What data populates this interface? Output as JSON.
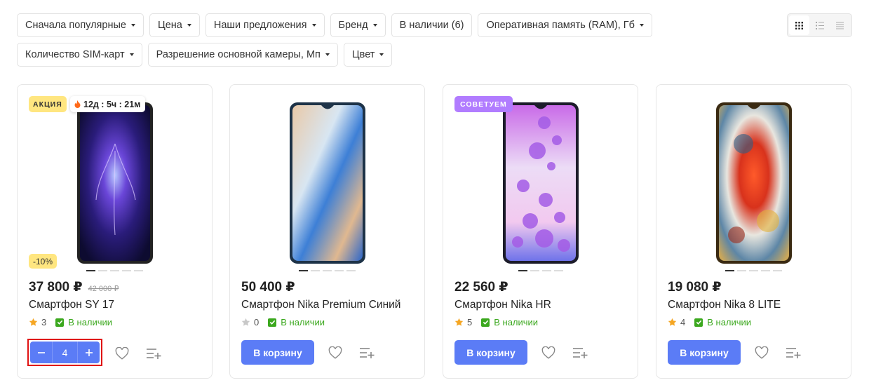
{
  "filters": {
    "row1": [
      "Сначала популярные",
      "Цена",
      "Наши предложения",
      "Бренд",
      "В наличии (6)",
      "Оперативная память (RAM), Гб"
    ],
    "row1_caret": [
      true,
      true,
      true,
      true,
      false,
      true
    ],
    "row2": [
      "Количество SIM-карт",
      "Разрешение основной камеры, Мп",
      "Цвет"
    ]
  },
  "view_modes": [
    "grid-view-icon",
    "list-view-icon",
    "compact-list-icon"
  ],
  "colors": {
    "accent": "#5b7cf6",
    "in_stock": "#3ba81e",
    "promo_badge": "#ffe680",
    "recommend_badge": "#b17cff",
    "highlight": "#e01212"
  },
  "products": [
    {
      "badge": "АКЦИЯ",
      "timer": "12д : 5ч : 21м",
      "discount": "-10%",
      "price": "37 800 ₽",
      "old_price": "42 000 ₽",
      "title": "Смартфон SY 17",
      "rating": "3",
      "rating_active": true,
      "stock": "В наличии",
      "quantity": "4",
      "cart_label": ""
    },
    {
      "price": "50 400 ₽",
      "title": "Смартфон Nika Premium Синий",
      "rating": "0",
      "rating_active": false,
      "stock": "В наличии",
      "cart_label": "В корзину"
    },
    {
      "badge": "СОВЕТУЕМ",
      "price": "22 560 ₽",
      "title": "Смартфон Nika HR",
      "rating": "5",
      "rating_active": true,
      "stock": "В наличии",
      "cart_label": "В корзину"
    },
    {
      "price": "19 080 ₽",
      "title": "Смартфон Nika 8 LITE",
      "rating": "4",
      "rating_active": true,
      "stock": "В наличии",
      "cart_label": "В корзину"
    }
  ]
}
